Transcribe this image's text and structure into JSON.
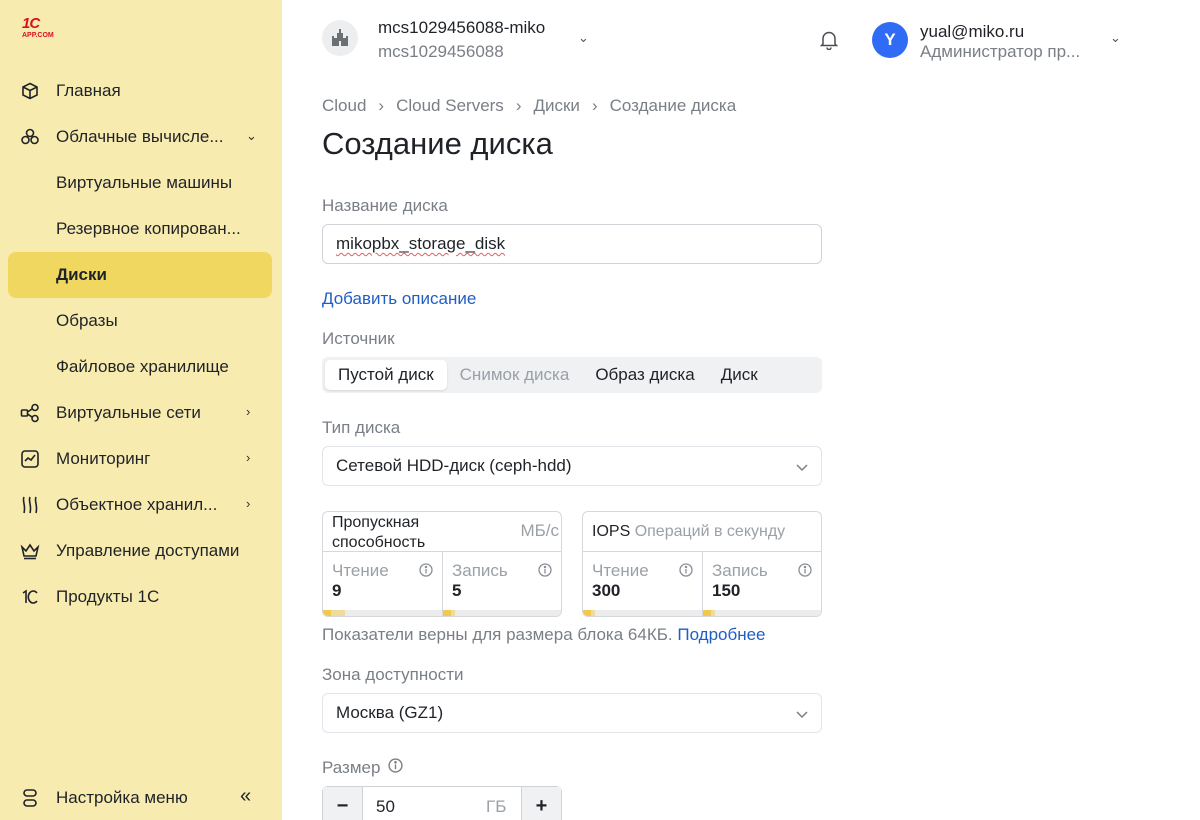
{
  "logo": {
    "main": "1С",
    "sub": "APP.COM"
  },
  "sidebar": {
    "items": [
      {
        "label": "Главная",
        "icon": "cube-icon"
      },
      {
        "label": "Облачные вычисле...",
        "icon": "cloud-compute-icon",
        "chevron": "⌄"
      },
      {
        "label": "Виртуальные машины"
      },
      {
        "label": "Резервное копирован..."
      },
      {
        "label": "Диски",
        "active": true
      },
      {
        "label": "Образы"
      },
      {
        "label": "Файловое хранилище"
      },
      {
        "label": "Виртуальные сети",
        "icon": "network-icon",
        "chevron": "›"
      },
      {
        "label": "Мониторинг",
        "icon": "monitoring-icon",
        "chevron": "›"
      },
      {
        "label": "Объектное хранил...",
        "icon": "object-storage-icon",
        "chevron": "›"
      },
      {
        "label": "Управление доступами",
        "icon": "crown-icon"
      },
      {
        "label": "Продукты 1С",
        "icon": "1c-icon"
      }
    ],
    "footer_label": "Настройка меню",
    "collapse_glyph": "«"
  },
  "header": {
    "project_name": "mcs1029456088-miko",
    "project_id": "mcs1029456088",
    "user_initial": "Y",
    "user_email": "yual@miko.ru",
    "user_role": "Администратор пр...",
    "accent": "#2f6bf5"
  },
  "breadcrumb": [
    "Cloud",
    "Cloud Servers",
    "Диски",
    "Создание диска"
  ],
  "page_title": "Создание диска",
  "form": {
    "name_label": "Название диска",
    "name_value": "mikopbx_storage_disk",
    "add_description": "Добавить описание",
    "source_label": "Источник",
    "source_options": [
      "Пустой диск",
      "Снимок диска",
      "Образ диска",
      "Диск"
    ],
    "source_selected": "Пустой диск",
    "disk_type_label": "Тип диска",
    "disk_type_value": "Сетевой HDD-диск (ceph-hdd)",
    "throughput": {
      "title": "Пропускная способность",
      "unit": "МБ/с",
      "read_label": "Чтение",
      "read_value": "9",
      "write_label": "Запись",
      "write_value": "5"
    },
    "iops": {
      "title": "IOPS",
      "unit": "Операций в секунду",
      "read_label": "Чтение",
      "read_value": "300",
      "write_label": "Запись",
      "write_value": "150"
    },
    "hint_text": "Показатели верны для размера блока 64КБ.",
    "hint_link": "Подробнее",
    "zone_label": "Зона доступности",
    "zone_value": "Москва (GZ1)",
    "size_label": "Размер",
    "size_value": "50",
    "size_unit": "ГБ",
    "minus": "−",
    "plus": "+"
  }
}
